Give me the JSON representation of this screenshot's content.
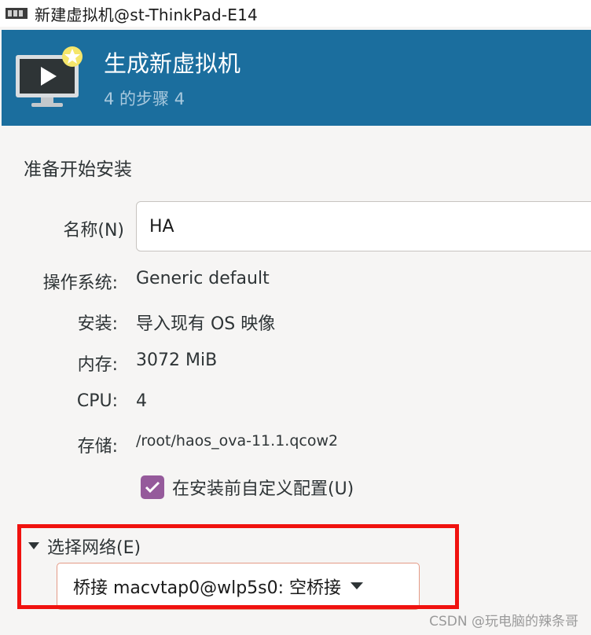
{
  "window": {
    "title": "新建虚拟机@st-ThinkPad-E14"
  },
  "header": {
    "title": "生成新虚拟机",
    "step": "4 的步骤 4"
  },
  "section": {
    "title": "准备开始安装"
  },
  "name_field": {
    "label": "名称(N)",
    "value": "HA"
  },
  "details": {
    "os_label": "操作系统:",
    "os_value": "Generic default",
    "install_label": "安装:",
    "install_value": "导入现有 OS 映像",
    "memory_label": "内存:",
    "memory_value": "3072 MiB",
    "cpu_label": "CPU:",
    "cpu_value": "4",
    "storage_label": "存储:",
    "storage_value": "/root/haos_ova-11.1.qcow2"
  },
  "customize": {
    "label": "在安装前自定义配置(U)",
    "checked": true
  },
  "network": {
    "expander_label": "选择网络(E)",
    "selected": "桥接 macvtap0@wlp5s0: 空桥接"
  },
  "watermark": "CSDN @玩电脑的辣条哥",
  "colors": {
    "header_bg": "#1b6e9e",
    "checkbox": "#955a9b",
    "highlight": "#f0120f"
  }
}
